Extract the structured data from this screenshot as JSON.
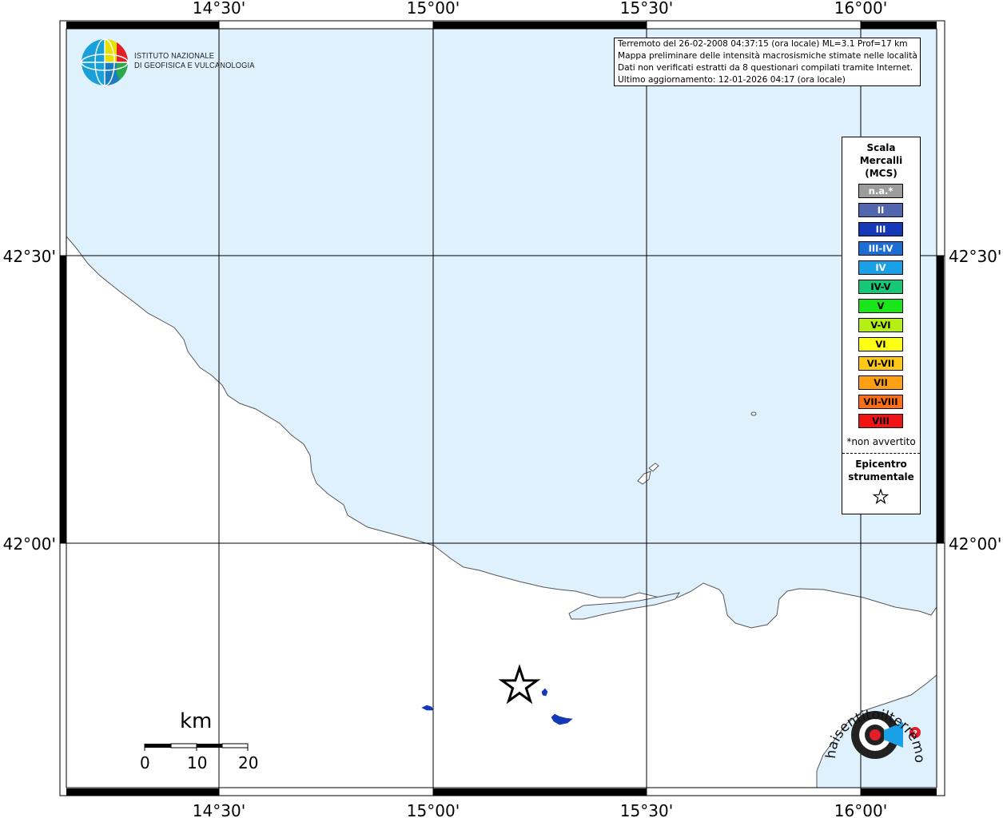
{
  "map": {
    "lon_labels": [
      "14°30'",
      "15°00'",
      "15°30'",
      "16°00'"
    ],
    "lat_labels": [
      "42°30'",
      "42°00'"
    ],
    "land_color": "#ffffff",
    "sea_color": "#dff1fc"
  },
  "logo": {
    "org_line1": "ISTITUTO NAZIONALE",
    "org_line2": "DI GEOFISICA E VULCANOLOGIA"
  },
  "info": {
    "line1": "Terremoto del 26-02-2008 04:37:15 (ora locale) ML=3.1 Prof=17 km",
    "line2": "Mappa preliminare delle intensità macrosismiche stimate nelle località",
    "line3": "Dati non verificati estratti da 8 questionari compilati tramite Internet.",
    "line4": "Ultimo aggiornamento: 12-01-2026 04:17 (ora locale)"
  },
  "legend": {
    "title_line1": "Scala",
    "title_line2": "Mercalli",
    "title_line3": "(MCS)",
    "items": [
      {
        "label": "n.a.*",
        "color": "#9c9c9c",
        "text_color": "#ffffff"
      },
      {
        "label": "II",
        "color": "#5266b0",
        "text_color": "#ffffff"
      },
      {
        "label": "III",
        "color": "#1438b8",
        "text_color": "#ffffff"
      },
      {
        "label": "III-IV",
        "color": "#1c6ed4",
        "text_color": "#ffffff"
      },
      {
        "label": "IV",
        "color": "#1aa0e6",
        "text_color": "#ffffff"
      },
      {
        "label": "IV-V",
        "color": "#14c878",
        "text_color": "#000000"
      },
      {
        "label": "V",
        "color": "#19e619",
        "text_color": "#000000"
      },
      {
        "label": "V-VI",
        "color": "#b4f014",
        "text_color": "#000000"
      },
      {
        "label": "VI",
        "color": "#ffff14",
        "text_color": "#000000"
      },
      {
        "label": "VI-VII",
        "color": "#ffc814",
        "text_color": "#000000"
      },
      {
        "label": "VII",
        "color": "#ffa014",
        "text_color": "#000000"
      },
      {
        "label": "VII-VIII",
        "color": "#ff6e14",
        "text_color": "#000000"
      },
      {
        "label": "VIII",
        "color": "#f01414",
        "text_color": "#000000"
      }
    ],
    "note": "*non avvertito",
    "epicenter_line1": "Epicentro",
    "epicenter_line2": "strumentale"
  },
  "scalebar": {
    "unit": "km",
    "ticks": [
      "0",
      "10",
      "20"
    ]
  },
  "badge": {
    "text": "haisentitoilterremoto.it www."
  },
  "intensity_points_color": "#1438b8"
}
